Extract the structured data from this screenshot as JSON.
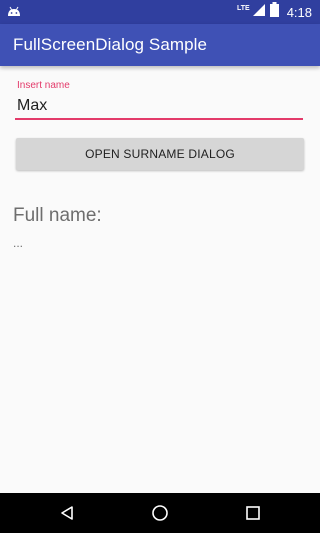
{
  "status_bar": {
    "network_label": "LTE",
    "time": "4:18",
    "icons": [
      "android-notification-icon",
      "signal-icon",
      "battery-icon"
    ]
  },
  "app_bar": {
    "title": "FullScreenDialog Sample"
  },
  "form": {
    "name_label": "Insert name",
    "name_value": "Max",
    "open_button_label": "OPEN SURNAME DIALOG"
  },
  "result": {
    "label": "Full name:",
    "value": "..."
  },
  "nav_bar": {
    "icons": [
      "back-icon",
      "home-icon",
      "recents-icon"
    ]
  },
  "colors": {
    "primary": "#3f51b5",
    "primary_dark": "#303f9f",
    "accent": "#e33a6a",
    "button_bg": "#d6d6d6"
  }
}
